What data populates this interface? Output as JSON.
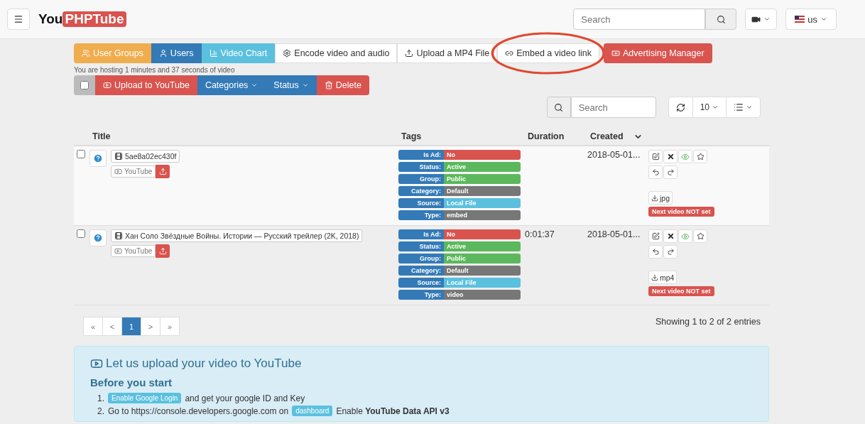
{
  "navbar": {
    "logo_plain": "You",
    "logo_badge": "PHPTube",
    "search": {
      "placeholder": "Search"
    },
    "language": "us"
  },
  "menu_buttons": [
    {
      "label": "User Groups",
      "kind": "warning",
      "circled": false
    },
    {
      "label": "Users",
      "kind": "primary",
      "circled": false
    },
    {
      "label": "Video Chart",
      "kind": "info",
      "circled": false
    },
    {
      "label": "Encode video and audio",
      "kind": "default",
      "circled": false
    },
    {
      "label": "Upload a MP4 File",
      "kind": "default",
      "circled": false
    },
    {
      "label": "Embed a video link",
      "kind": "default",
      "circled": true
    },
    {
      "label": "Advertising Manager",
      "kind": "danger",
      "circled": false
    }
  ],
  "hosting_note": "You are hosting 1 minutes and 37 seconds of video",
  "bulk_actions": {
    "checked": false,
    "buttons": [
      {
        "label": "Upload to YouTube",
        "kind": "danger",
        "dropdown": false
      },
      {
        "label": "Categories",
        "kind": "primary",
        "dropdown": true
      },
      {
        "label": "Status",
        "kind": "primary",
        "dropdown": true
      },
      {
        "label": "Delete",
        "kind": "danger",
        "dropdown": false
      }
    ]
  },
  "table_toolbar": {
    "search": {
      "placeholder": "Search"
    },
    "page_size": "10"
  },
  "table": {
    "columns": [
      "Title",
      "Tags",
      "Duration",
      "Created"
    ],
    "rows": [
      {
        "checked": false,
        "title": "5ae8a02ec430f",
        "youtube": "YouTube",
        "tags": [
          {
            "label": "Is Ad:",
            "value": "No",
            "color": "#d9534f"
          },
          {
            "label": "Status:",
            "value": "Active",
            "color": "#5cb85c"
          },
          {
            "label": "Group:",
            "value": "Public",
            "color": "#5cb85c"
          },
          {
            "label": "Category:",
            "value": "Default",
            "color": "#777777"
          },
          {
            "label": "Source:",
            "value": "Local File",
            "color": "#5bc0de"
          },
          {
            "label": "Type:",
            "value": "embed",
            "color": "#777777"
          }
        ],
        "created": "2018-05-01...",
        "download": "jpg",
        "next_video": "Next video NOT set"
      },
      {
        "checked": false,
        "title": "Хан Соло Звёздные Войны. Истории — Русский трейлер (2K, 2018)",
        "youtube": "YouTube",
        "tags": [
          {
            "label": "Is Ad:",
            "value": "No",
            "color": "#d9534f"
          },
          {
            "label": "Status:",
            "value": "Active",
            "color": "#5cb85c"
          },
          {
            "label": "Group:",
            "value": "Public",
            "color": "#5cb85c"
          },
          {
            "label": "Category:",
            "value": "Default",
            "color": "#777777"
          },
          {
            "label": "Source:",
            "value": "Local File",
            "color": "#5bc0de"
          },
          {
            "label": "Type:",
            "value": "video",
            "color": "#777777"
          }
        ],
        "duration": "0:01:37",
        "created": "2018-05-01...",
        "download": "mp4",
        "next_video": "Next video NOT set"
      }
    ]
  },
  "pagination": [
    {
      "label": "«",
      "selected": false
    },
    {
      "label": "<",
      "selected": false
    },
    {
      "label": "1",
      "selected": true
    },
    {
      "label": ">",
      "selected": false
    },
    {
      "label": "»",
      "selected": false
    }
  ],
  "entries_info": "Showing 1 to 2 of 2 entries",
  "info_panel": {
    "title": "Let us upload your video to YouTube",
    "subtitle": "Before you start",
    "steps": [
      {
        "number": "1.",
        "parts": [
          {
            "kind": "badge",
            "text": "Enable Google Login"
          },
          {
            "kind": "text",
            "text": "and get your google ID and Key"
          }
        ]
      },
      {
        "number": "2.",
        "parts": [
          {
            "kind": "text",
            "text": "Go to https://console.developers.google.com on"
          },
          {
            "kind": "badge",
            "text": "dashboard"
          },
          {
            "kind": "text",
            "text": "Enable **YouTube Data API v3**"
          }
        ]
      }
    ]
  }
}
